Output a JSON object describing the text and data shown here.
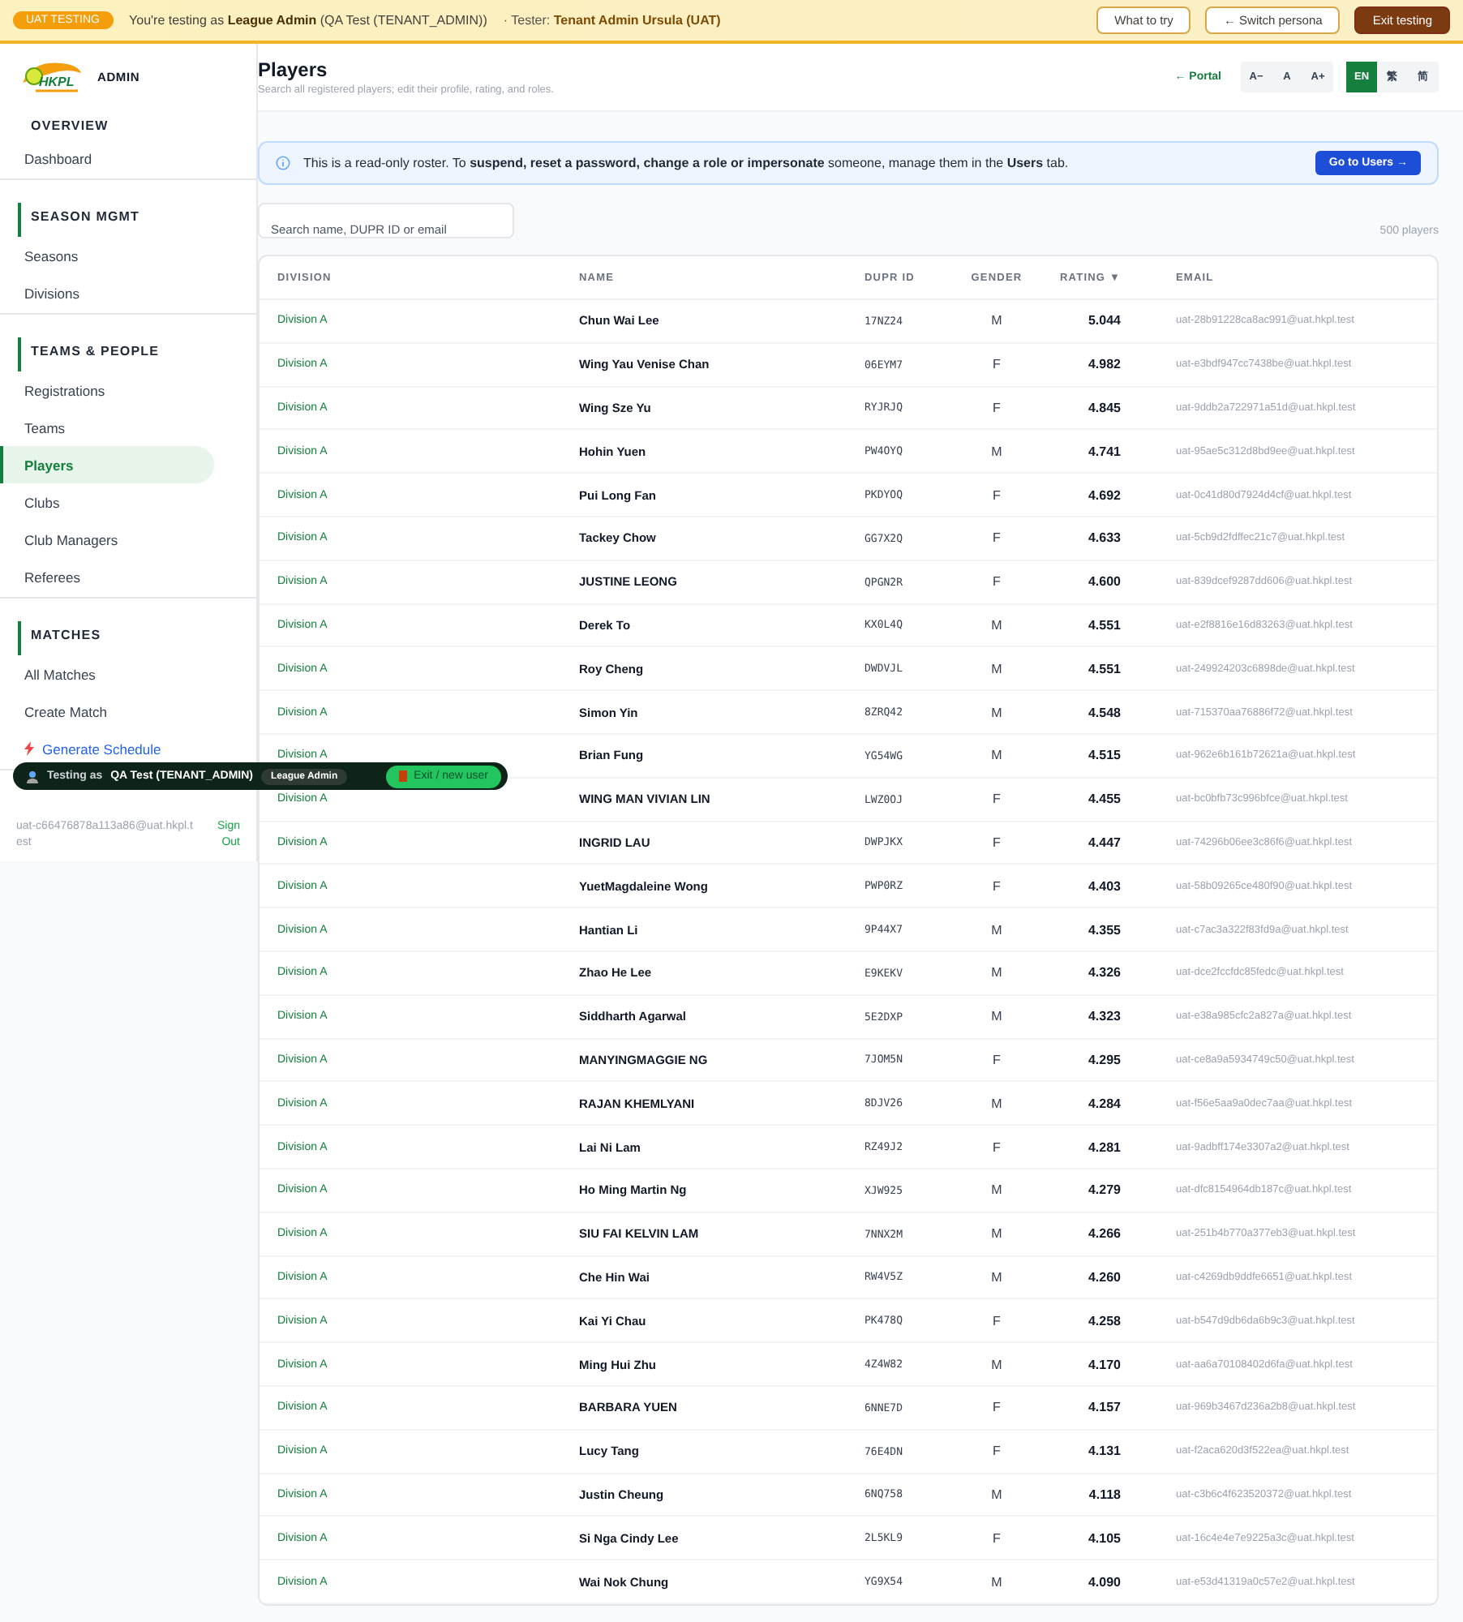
{
  "uat_banner": {
    "badge": "UAT TESTING",
    "message": "You're testing as **League Admin** (QA Test (TENANT_ADMIN))",
    "tester": "· Tester: **Tenant Admin Ursula (UAT)**",
    "buttons": [
      {
        "label": "What to try",
        "kind": "outline"
      },
      {
        "label": "← Switch persona",
        "kind": "outline"
      },
      {
        "label": "Exit testing",
        "kind": "solid"
      }
    ]
  },
  "sidebar": {
    "logo_text": "HKPL",
    "title": "ADMIN",
    "sections": [
      {
        "title": "OVERVIEW",
        "items": [
          {
            "label": "Dashboard",
            "selected": false,
            "kind": "link"
          }
        ]
      },
      {
        "title": "SEASON MGMT",
        "items": [
          {
            "label": "Seasons",
            "selected": false,
            "kind": "link"
          },
          {
            "label": "Divisions",
            "selected": false,
            "kind": "link"
          }
        ]
      },
      {
        "title": "TEAMS & PEOPLE",
        "items": [
          {
            "label": "Registrations",
            "selected": false,
            "kind": "link"
          },
          {
            "label": "Teams",
            "selected": false,
            "kind": "link"
          },
          {
            "label": "Players",
            "selected": true,
            "kind": "link"
          },
          {
            "label": "Clubs",
            "selected": false,
            "kind": "link"
          },
          {
            "label": "Club Managers",
            "selected": false,
            "kind": "link"
          },
          {
            "label": "Referees",
            "selected": false,
            "kind": "link"
          }
        ]
      },
      {
        "title": "MATCHES",
        "items": [
          {
            "label": "All Matches",
            "selected": false,
            "kind": "link"
          },
          {
            "label": "Create Match",
            "selected": false,
            "kind": "link"
          },
          {
            "label": "Generate Schedule",
            "selected": false,
            "kind": "action"
          }
        ]
      }
    ],
    "user_email": "uat-c66476878a113a86@uat.hkpl.test",
    "sign_out": "Sign Out"
  },
  "header": {
    "title": "Players",
    "subtitle": "Search all registered players; edit their profile, rating, and roles.",
    "portal_link": "← Portal",
    "font_sizes": [
      {
        "label": "A−",
        "selected": false
      },
      {
        "label": "A",
        "selected": false
      },
      {
        "label": "A+",
        "selected": false
      }
    ],
    "languages": [
      {
        "label": "EN",
        "selected": true
      },
      {
        "label": "繁",
        "selected": false
      },
      {
        "label": "简",
        "selected": false
      }
    ]
  },
  "notice": {
    "text": "This is a read-only roster. To **suspend, reset a password, change a role or impersonate** someone, manage them in the **Users** tab.",
    "button": "Go to Users →"
  },
  "search": {
    "placeholder": "Search name, DUPR ID or email"
  },
  "count": "500 players",
  "table": {
    "columns": [
      "DIVISION",
      "NAME",
      "DUPR ID",
      "GENDER",
      "RATING ▼",
      "EMAIL"
    ],
    "rows": [
      [
        "Division A",
        "Chun Wai Lee",
        "17NZ24",
        "M",
        "5.044",
        "uat-28b91228ca8ac991@uat.hkpl.test"
      ],
      [
        "Division A",
        "Wing Yau Venise Chan",
        "06EYM7",
        "F",
        "4.982",
        "uat-e3bdf947cc7438be@uat.hkpl.test"
      ],
      [
        "Division A",
        "Wing Sze Yu",
        "RYJRJQ",
        "F",
        "4.845",
        "uat-9ddb2a722971a51d@uat.hkpl.test"
      ],
      [
        "Division A",
        "Hohin Yuen",
        "PW4OYQ",
        "M",
        "4.741",
        "uat-95ae5c312d8bd9ee@uat.hkpl.test"
      ],
      [
        "Division A",
        "Pui Long Fan",
        "PKDYOQ",
        "F",
        "4.692",
        "uat-0c41d80d7924d4cf@uat.hkpl.test"
      ],
      [
        "Division A",
        "Tackey Chow",
        "GG7X2Q",
        "F",
        "4.633",
        "uat-5cb9d2fdffec21c7@uat.hkpl.test"
      ],
      [
        "Division A",
        "JUSTINE LEONG",
        "QPGN2R",
        "F",
        "4.600",
        "uat-839dcef9287dd606@uat.hkpl.test"
      ],
      [
        "Division A",
        "Derek To",
        "KX0L4Q",
        "M",
        "4.551",
        "uat-e2f8816e16d83263@uat.hkpl.test"
      ],
      [
        "Division A",
        "Roy Cheng",
        "DWDVJL",
        "M",
        "4.551",
        "uat-249924203c6898de@uat.hkpl.test"
      ],
      [
        "Division A",
        "Simon Yin",
        "8ZRQ42",
        "M",
        "4.548",
        "uat-715370aa76886f72@uat.hkpl.test"
      ],
      [
        "Division A",
        "Brian Fung",
        "YG54WG",
        "M",
        "4.515",
        "uat-962e6b161b72621a@uat.hkpl.test"
      ],
      [
        "Division A",
        "WING MAN VIVIAN LIN",
        "LWZ0OJ",
        "F",
        "4.455",
        "uat-bc0bfb73c996bfce@uat.hkpl.test"
      ],
      [
        "Division A",
        "INGRID LAU",
        "DWPJKX",
        "F",
        "4.447",
        "uat-74296b06ee3c86f6@uat.hkpl.test"
      ],
      [
        "Division A",
        "YuetMagdaleine Wong",
        "PWP0RZ",
        "F",
        "4.403",
        "uat-58b09265ce480f90@uat.hkpl.test"
      ],
      [
        "Division A",
        "Hantian Li",
        "9P44X7",
        "M",
        "4.355",
        "uat-c7ac3a322f83fd9a@uat.hkpl.test"
      ],
      [
        "Division A",
        "Zhao He Lee",
        "E9KEKV",
        "M",
        "4.326",
        "uat-dce2fccfdc85fedc@uat.hkpl.test"
      ],
      [
        "Division A",
        "Siddharth Agarwal",
        "5E2DXP",
        "M",
        "4.323",
        "uat-e38a985cfc2a827a@uat.hkpl.test"
      ],
      [
        "Division A",
        "MANYINGMAGGIE NG",
        "7JOM5N",
        "F",
        "4.295",
        "uat-ce8a9a5934749c50@uat.hkpl.test"
      ],
      [
        "Division A",
        "RAJAN KHEMLYANI",
        "8DJV26",
        "M",
        "4.284",
        "uat-f56e5aa9a0dec7aa@uat.hkpl.test"
      ],
      [
        "Division A",
        "Lai Ni Lam",
        "RZ49J2",
        "F",
        "4.281",
        "uat-9adbff174e3307a2@uat.hkpl.test"
      ],
      [
        "Division A",
        "Ho Ming Martin Ng",
        "XJW925",
        "M",
        "4.279",
        "uat-dfc8154964db187c@uat.hkpl.test"
      ],
      [
        "Division A",
        "SIU FAI KELVIN LAM",
        "7NNX2M",
        "M",
        "4.266",
        "uat-251b4b770a377eb3@uat.hkpl.test"
      ],
      [
        "Division A",
        "Che Hin Wai",
        "RW4V5Z",
        "M",
        "4.260",
        "uat-c4269db9ddfe6651@uat.hkpl.test"
      ],
      [
        "Division A",
        "Kai Yi Chau",
        "PK478Q",
        "F",
        "4.258",
        "uat-b547d9db6da6b9c3@uat.hkpl.test"
      ],
      [
        "Division A",
        "Ming Hui Zhu",
        "4Z4W82",
        "M",
        "4.170",
        "uat-aa6a70108402d6fa@uat.hkpl.test"
      ],
      [
        "Division A",
        "BARBARA YUEN",
        "6NNE7D",
        "F",
        "4.157",
        "uat-969b3467d236a2b8@uat.hkpl.test"
      ],
      [
        "Division A",
        "Lucy Tang",
        "76E4DN",
        "F",
        "4.131",
        "uat-f2aca620d3f522ea@uat.hkpl.test"
      ],
      [
        "Division A",
        "Justin Cheung",
        "6NQ758",
        "M",
        "4.118",
        "uat-c3b6c4f623520372@uat.hkpl.test"
      ],
      [
        "Division A",
        "Si Nga Cindy Lee",
        "2L5KL9",
        "F",
        "4.105",
        "uat-16c4e4e7e9225a3c@uat.hkpl.test"
      ],
      [
        "Division A",
        "Wai Nok Chung",
        "YG9X54",
        "M",
        "4.090",
        "uat-e53d41319a0c57e2@uat.hkpl.test"
      ]
    ]
  },
  "testing_pill": {
    "label": "Testing as",
    "persona": "QA Test (TENANT_ADMIN)",
    "role": "League Admin",
    "button": "Exit / new user"
  }
}
